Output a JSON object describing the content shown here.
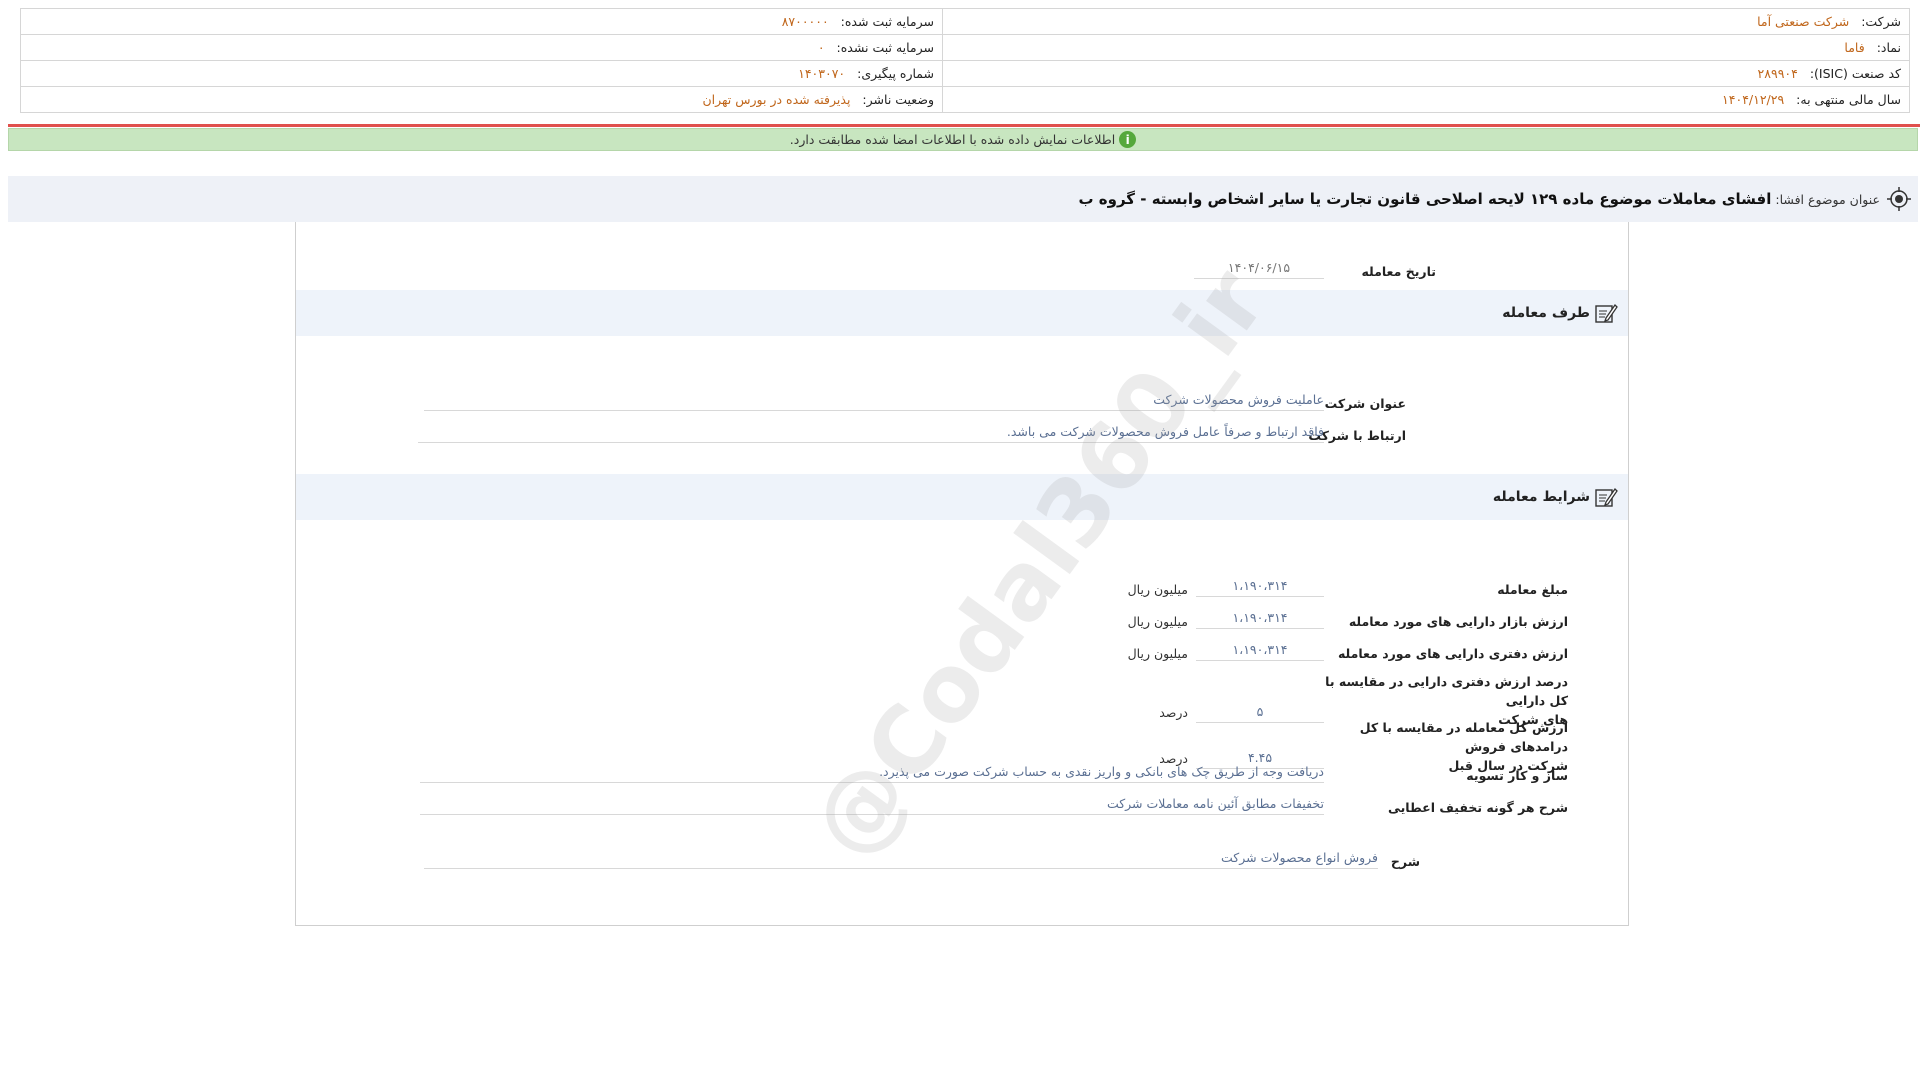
{
  "header": {
    "company_label": "شرکت:",
    "company_value": "شرکت صنعتی آما",
    "registered_capital_label": "سرمایه ثبت شده:",
    "registered_capital_value": "۸۷۰۰۰۰۰",
    "symbol_label": "نماد:",
    "symbol_value": "فاما",
    "unregistered_capital_label": "سرمایه ثبت نشده:",
    "unregistered_capital_value": "۰",
    "isic_label": "کد صنعت (ISIC):",
    "isic_value": "۲۸۹۹۰۴",
    "tracking_label": "شماره پیگیری:",
    "tracking_value": "۱۴۰۳۰۷۰",
    "fiscal_year_label": "سال مالی منتهی به:",
    "fiscal_year_value": "۱۴۰۴/۱۲/۲۹",
    "publisher_status_label": "وضعیت ناشر:",
    "publisher_status_value": "پذیرفته شده در بورس تهران"
  },
  "notice": {
    "text": "اطلاعات نمایش داده شده با اطلاعات امضا شده مطابقت دارد.",
    "icon": "info-icon",
    "icon_glyph": "i",
    "color": "#c8e6c0"
  },
  "title_bar": {
    "label": "عنوان موضوع افشا:",
    "title": "افشای معاملات موضوع ماده ۱۲۹ لایحه اصلاحی قانون تجارت یا سایر اشخاص وابسته - گروه ب"
  },
  "transaction_date": {
    "label": "تاریخ معامله",
    "value": "۱۴۰۴/۰۶/۱۵"
  },
  "counterparty": {
    "section_title": "طرف معامله",
    "company_title_label": "عنوان شرکت",
    "company_title_value": "عاملیت فروش محصولات شرکت",
    "relation_label": "ارتباط با شرکت",
    "relation_value": "فاقد ارتباط و صرفاً عامل فروش محصولات شرکت می باشد."
  },
  "terms": {
    "section_title": "شرایط معامله",
    "amount_label": "مبلغ معامله",
    "amount_value": "۱،۱۹۰،۳۱۴",
    "amount_unit": "میلیون ریال",
    "market_value_label": "ارزش بازار دارایی های مورد معامله",
    "market_value_value": "۱،۱۹۰،۳۱۴",
    "market_value_unit": "میلیون ریال",
    "book_value_label": "ارزش دفتری دارایی های مورد معامله",
    "book_value_value": "۱،۱۹۰،۳۱۴",
    "book_value_unit": "میلیون ریال",
    "book_pct_label_1": "درصد ارزش دفتری دارایی در مقایسه با کل دارایی",
    "book_pct_label_2": "های شرکت",
    "book_pct_value": "۵",
    "book_pct_unit": "درصد",
    "revenue_pct_label_1": "ارزش کل معامله در مقایسه با کل درامدهای فروش",
    "revenue_pct_label_2": "شرکت در سال قبل",
    "revenue_pct_value": "۴.۴۵",
    "revenue_pct_unit": "درصد",
    "settlement_label": "ساز و کار تسویه",
    "settlement_value": "دریافت وجه از طریق چک های بانکی و واریز نقدی به حساب شرکت صورت می پذیرد.",
    "discount_label": "شرح هر گونه تخفیف اعطایی",
    "discount_value": "تخفیفات مطابق آئین نامه معاملات شرکت",
    "description_label": "شرح",
    "description_value": "فروش انواع محصولات شرکت"
  },
  "watermark": {
    "text": "@Codal360_ir"
  },
  "colors": {
    "value_orange": "#c0661b",
    "value_blue": "#5a6f92",
    "notice_green": "#c8e6c0",
    "divider_red": "#e0504d",
    "title_bg": "#eef1f7"
  }
}
